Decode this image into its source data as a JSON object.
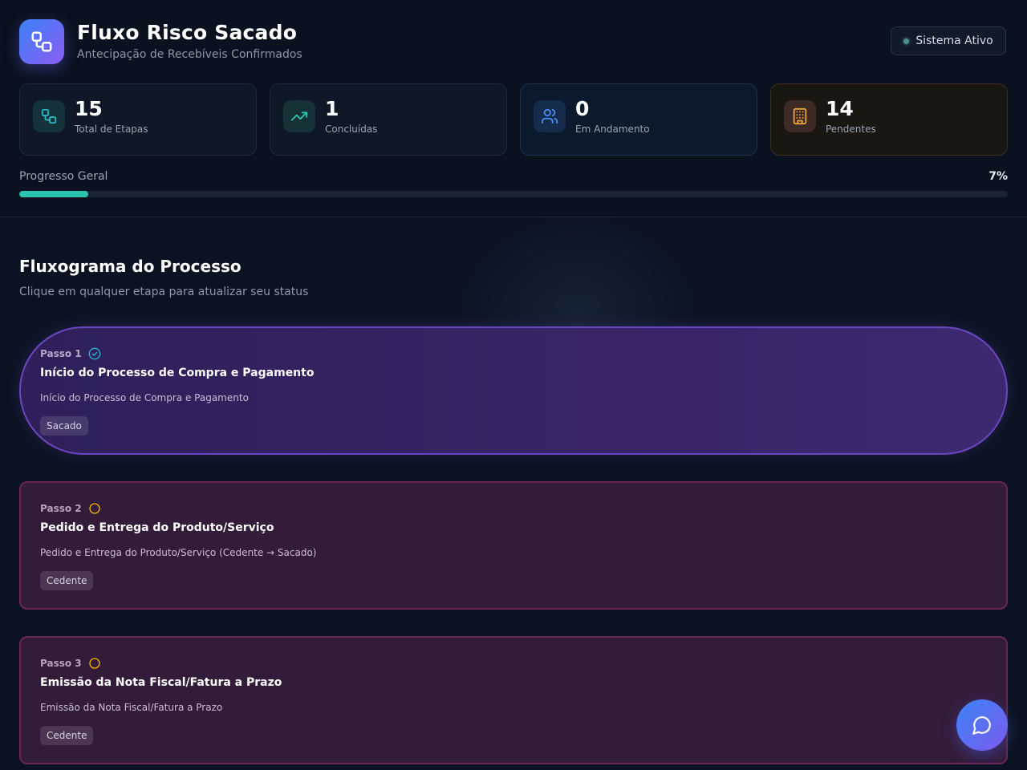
{
  "header": {
    "title": "Fluxo Risco Sacado",
    "subtitle": "Antecipação de Recebíveis Confirmados",
    "status": "Sistema Ativo"
  },
  "stats": [
    {
      "value": "15",
      "label": "Total de Etapas",
      "icon": "workflow-icon"
    },
    {
      "value": "1",
      "label": "Concluídas",
      "icon": "trending-up-icon"
    },
    {
      "value": "0",
      "label": "Em Andamento",
      "icon": "users-icon"
    },
    {
      "value": "14",
      "label": "Pendentes",
      "icon": "building-icon"
    }
  ],
  "progress": {
    "label": "Progresso Geral",
    "value_text": "7%",
    "fraction": 0.07
  },
  "section": {
    "title": "Fluxograma do Processo",
    "subtitle": "Clique em qualquer etapa para atualizar seu status"
  },
  "steps": [
    {
      "step": "Passo 1",
      "title": "Início do Processo de Compra e Pagamento",
      "description": "Início do Processo de Compra e Pagamento",
      "tag": "Sacado",
      "status": "completed"
    },
    {
      "step": "Passo 2",
      "title": "Pedido e Entrega do Produto/Serviço",
      "description": "Pedido e Entrega do Produto/Serviço (Cedente → Sacado)",
      "tag": "Cedente",
      "status": "pending"
    },
    {
      "step": "Passo 3",
      "title": "Emissão da Nota Fiscal/Fatura a Prazo",
      "description": "Emissão da Nota Fiscal/Fatura a Prazo",
      "tag": "Cedente",
      "status": "pending"
    }
  ],
  "colors": {
    "accent": "#2cc4b0",
    "completed": "#22b8cf",
    "pending": "#f5b301",
    "active_border": "#6b46c1",
    "pending_border": "#6b2654"
  }
}
